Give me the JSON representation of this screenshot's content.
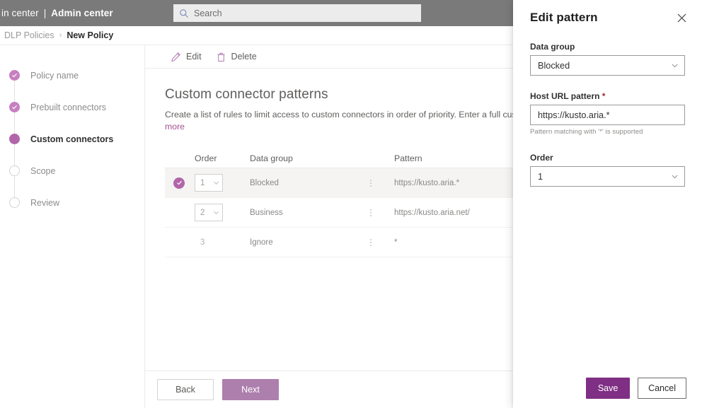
{
  "header": {
    "suite_prefix": "in center",
    "separator": "|",
    "app_name": "Admin center",
    "search_placeholder": "Search"
  },
  "breadcrumb": {
    "parent": "DLP Policies",
    "separator": "›",
    "current": "New Policy"
  },
  "wizard": {
    "steps": [
      {
        "label": "Policy name",
        "state": "done"
      },
      {
        "label": "Prebuilt connectors",
        "state": "done"
      },
      {
        "label": "Custom connectors",
        "state": "current"
      },
      {
        "label": "Scope",
        "state": "todo"
      },
      {
        "label": "Review",
        "state": "todo"
      }
    ]
  },
  "commandbar": {
    "edit_label": "Edit",
    "delete_label": "Delete"
  },
  "main": {
    "title": "Custom connector patterns",
    "description": "Create a list of rules to limit access to custom connectors in order of priority. Enter a full custom connector U",
    "description_link": "more",
    "table": {
      "columns": {
        "order": "Order",
        "data_group": "Data group",
        "pattern": "Pattern"
      },
      "rows": [
        {
          "order": "1",
          "data_group": "Blocked",
          "pattern": "https://kusto.aria.*",
          "selected": true,
          "order_editable": true
        },
        {
          "order": "2",
          "data_group": "Business",
          "pattern": "https://kusto.aria.net/",
          "selected": false,
          "order_editable": true
        },
        {
          "order": "3",
          "data_group": "Ignore",
          "pattern": "*",
          "selected": false,
          "order_editable": false
        }
      ]
    },
    "footer": {
      "back_label": "Back",
      "next_label": "Next"
    }
  },
  "panel": {
    "title": "Edit pattern",
    "close_label": "✕",
    "data_group": {
      "label": "Data group",
      "value": "Blocked"
    },
    "host_url": {
      "label": "Host URL pattern",
      "required_mark": "*",
      "value": "https://kusto.aria.*",
      "hint": "Pattern matching with '*' is supported"
    },
    "order": {
      "label": "Order",
      "value": "1"
    },
    "save_label": "Save",
    "cancel_label": "Cancel"
  },
  "colors": {
    "topbar": "#7a7a7a",
    "accent_purple": "#7f2f84",
    "step_current": "#b266aa",
    "step_done": "#c77fc0",
    "next_button": "#ad7fad",
    "link": "#a4508f"
  }
}
